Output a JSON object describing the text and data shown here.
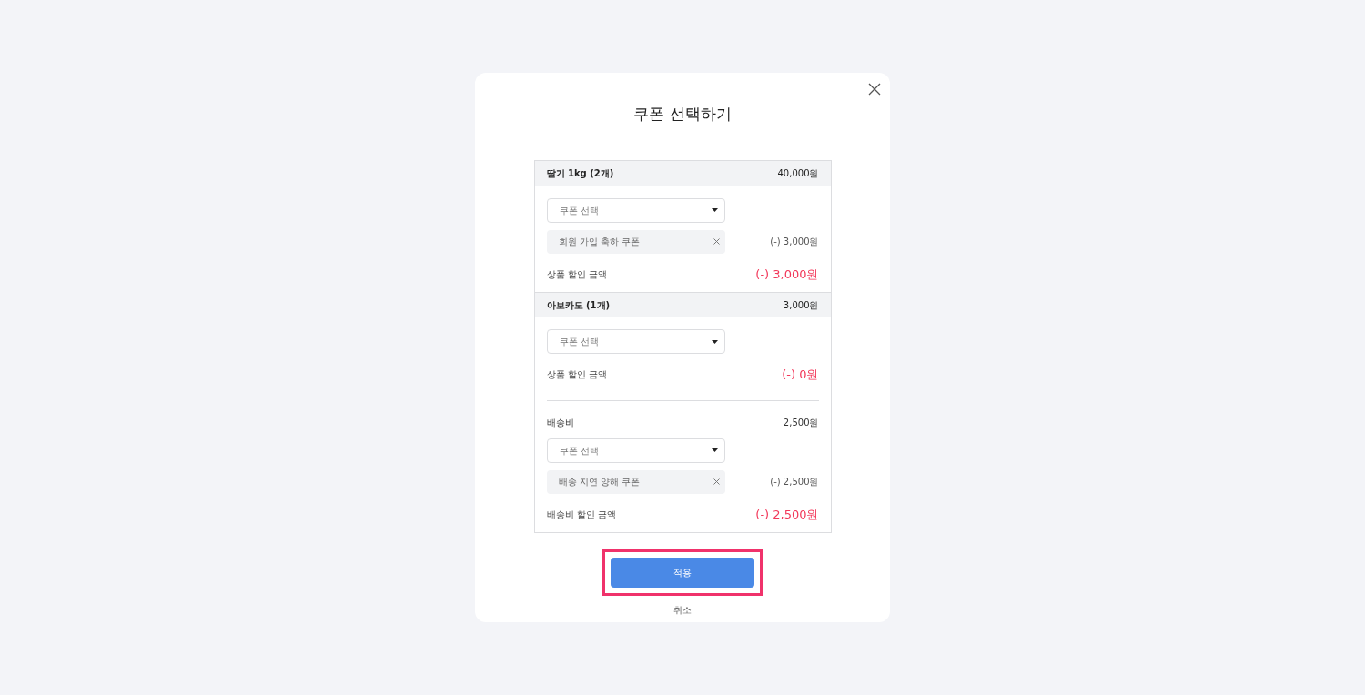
{
  "dialog": {
    "title": "쿠폰 선택하기"
  },
  "products": [
    {
      "name": "딸기 1kg (2개)",
      "price": "40,000원",
      "coupon_select": {
        "placeholder": "쿠폰 선택"
      },
      "applied_coupons": [
        {
          "name": "회원 가입 축하 쿠폰",
          "amount": "(-) 3,000원"
        }
      ],
      "discount_label": "상품 할인 금액",
      "discount_value": "(-) 3,000원"
    },
    {
      "name": "아보카도 (1개)",
      "price": "3,000원",
      "coupon_select": {
        "placeholder": "쿠폰 선택"
      },
      "discount_label": "상품 할인 금액",
      "discount_value": "(-) 0원"
    }
  ],
  "shipping": {
    "label": "배송비",
    "price": "2,500원",
    "coupon_select": {
      "placeholder": "쿠폰 선택"
    },
    "applied_coupons": [
      {
        "name": "배송 지연 양해 쿠폰",
        "amount": "(-) 2,500원"
      }
    ],
    "discount_label": "배송비 할인 금액",
    "discount_value": "(-) 2,500원"
  },
  "apply_button": {
    "label": "적용",
    "highlighted": true
  },
  "cancel_link": "취소"
}
